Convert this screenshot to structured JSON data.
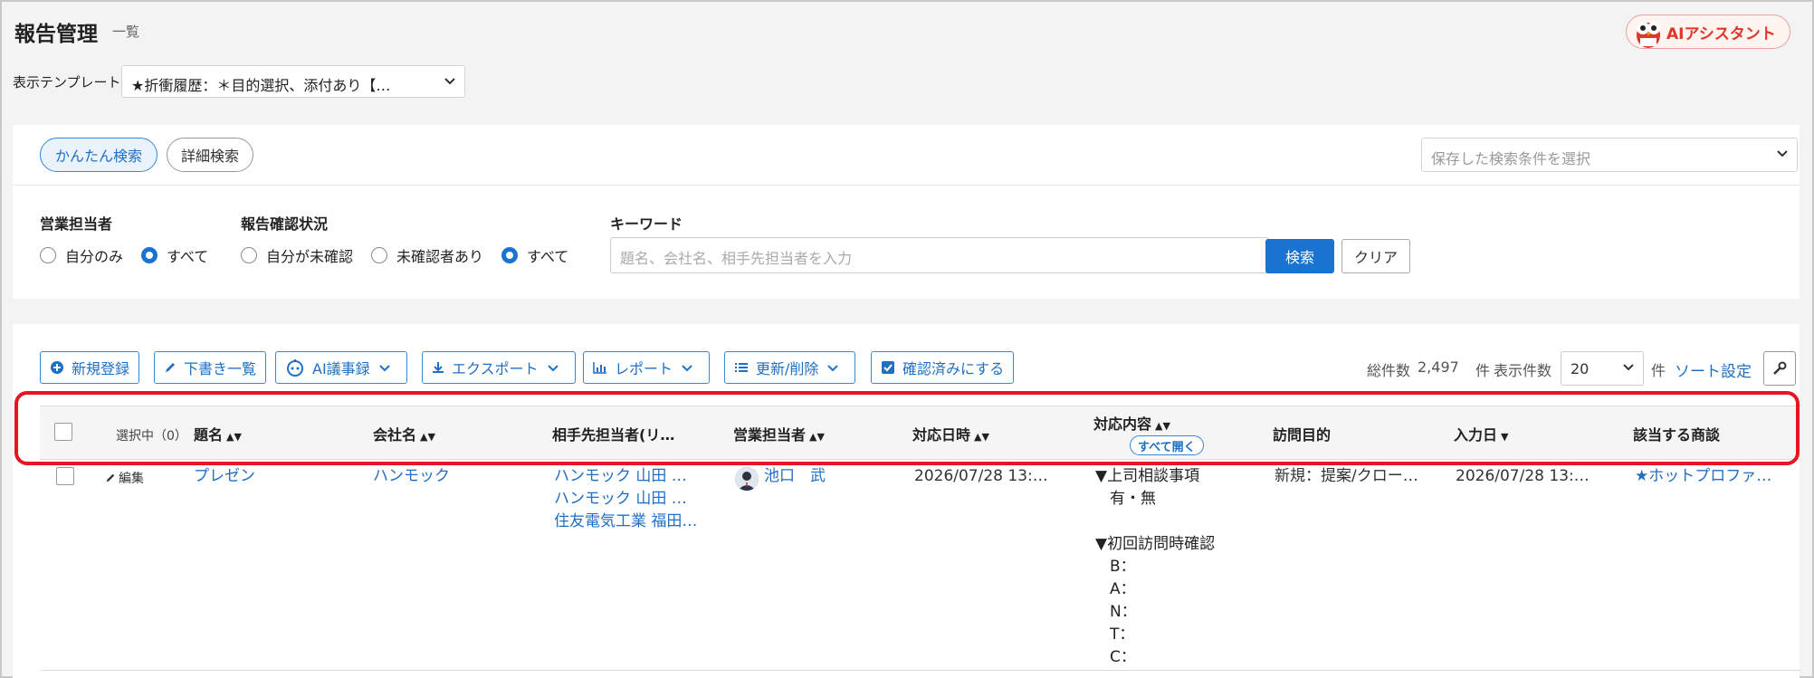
{
  "header": {
    "title": "報告管理",
    "subtitle": "一覧",
    "ai_assistant": "AIアシスタント",
    "template_label": "表示テンプレート",
    "template_value": "★折衝履歴：＊目的選択、添付あり【…"
  },
  "search": {
    "tabs": [
      "かんたん検索",
      "詳細検索"
    ],
    "saved_placeholder": "保存した検索条件を選択",
    "sales_rep_label": "営業担当者",
    "sales_rep_options": [
      "自分のみ",
      "すべて"
    ],
    "report_status_label": "報告確認状況",
    "report_status_options": [
      "自分が未確認",
      "未確認者あり",
      "すべて"
    ],
    "keyword_label": "キーワード",
    "keyword_placeholder": "題名、会社名、相手先担当者を入力",
    "search_button": "検索",
    "clear_button": "クリア"
  },
  "toolbar": {
    "new": "新規登録",
    "drafts": "下書き一覧",
    "ai_minutes": "AI議事録",
    "export": "エクスポート",
    "report": "レポート",
    "update_delete": "更新/削除",
    "mark_confirmed": "確認済みにする",
    "total_label": "総件数",
    "total_value": "2,497",
    "total_unit": "件",
    "per_page_label": "表示件数",
    "per_page_value": "20",
    "per_page_unit": "件",
    "sort_settings": "ソート設定"
  },
  "table": {
    "selected": "選択中（0）",
    "columns": {
      "title": "題名",
      "company": "会社名",
      "contact": "相手先担当者(リ…",
      "sales_rep": "営業担当者",
      "date": "対応日時",
      "content": "対応内容",
      "expand_all": "すべて開く",
      "purpose": "訪問目的",
      "input_date": "入力日",
      "deal": "該当する商談"
    },
    "rows": [
      {
        "edit": "編集",
        "title": "プレゼン",
        "company": "ハンモック",
        "contacts": [
          "ハンモック 山田 …",
          "ハンモック 山田 …",
          "住友電気工業 福田…"
        ],
        "sales_rep": "池口　武",
        "date": "2026/07/28 13:…",
        "content_lines": [
          "▼上司相談事項",
          "有・無",
          "",
          "▼初回訪問時確認",
          "B：",
          "A：",
          "N：",
          "T：",
          "C："
        ],
        "purpose": "新規：提案/クロー…",
        "input_date": "2026/07/28 13:…",
        "deal": "★ホットプロファ…"
      }
    ]
  }
}
